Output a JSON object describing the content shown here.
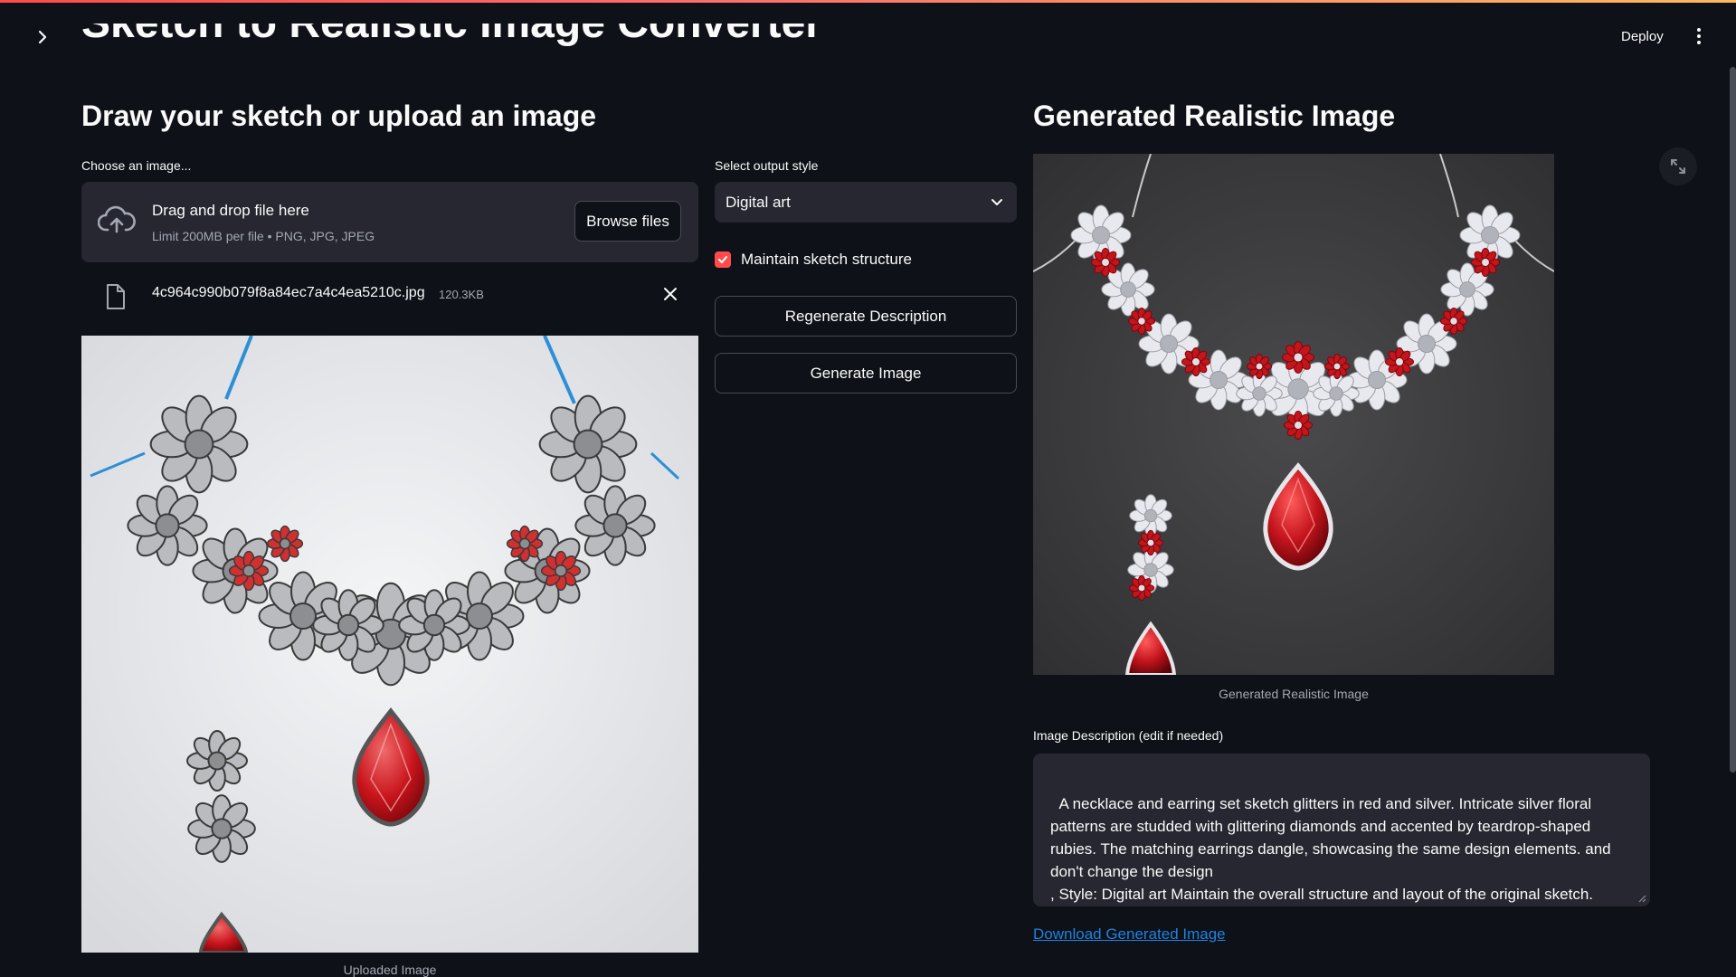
{
  "header": {
    "deploy_label": "Deploy"
  },
  "app": {
    "title": "Sketch to Realistic Image Converter"
  },
  "left": {
    "heading": "Draw your sketch or upload an image",
    "uploader_label": "Choose an image...",
    "dropzone_title": "Drag and drop file here",
    "dropzone_limit": "Limit 200MB per file • PNG, JPG, JPEG",
    "browse_label": "Browse files",
    "file": {
      "name": "4c964c990b079f8a84ec7a4c4ea5210c.jpg",
      "size": "120.3KB"
    },
    "image_caption": "Uploaded Image"
  },
  "controls": {
    "style_label": "Select output style",
    "style_value": "Digital art",
    "maintain_label": "Maintain sketch structure",
    "maintain_checked": true,
    "regenerate_label": "Regenerate Description",
    "generate_label": "Generate Image"
  },
  "right": {
    "heading": "Generated Realistic Image",
    "image_caption": "Generated Realistic Image",
    "desc_label": "Image Description (edit if needed)",
    "desc_text": "A necklace and earring set sketch glitters in red and silver. Intricate silver floral patterns are studded with glittering diamonds and accented by teardrop-shaped rubies. The matching earrings dangle, showcasing the same design elements. and don't change the design\n, Style: Digital art Maintain the overall structure and layout of the original sketch.",
    "download_label": "Download Generated Image"
  },
  "colors": {
    "background": "#0e1117",
    "panel": "#262730",
    "accent": "#ff4b4b",
    "link": "#1c83e1",
    "ruby": "#c4141c"
  },
  "icons": [
    "chevron-right-icon",
    "kebab-menu-icon",
    "cloud-upload-icon",
    "file-icon",
    "close-icon",
    "chevron-down-icon",
    "checkmark-icon",
    "expand-icon",
    "resize-grip-icon"
  ]
}
